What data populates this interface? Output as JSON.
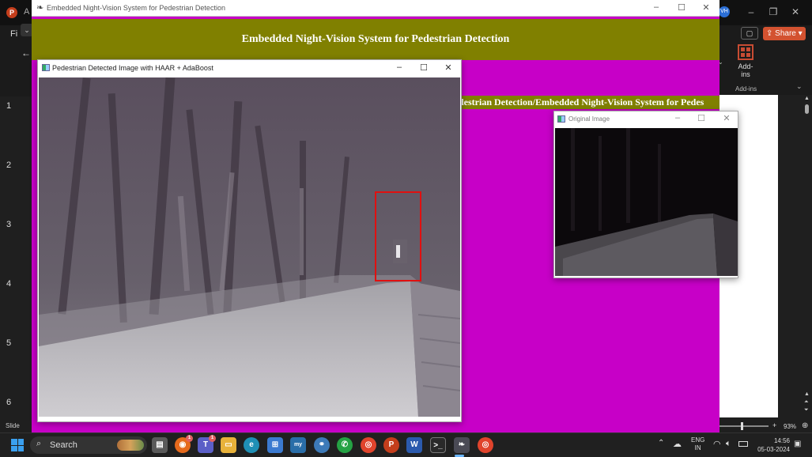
{
  "powerpoint": {
    "title_fragment": "A",
    "file_tab": "Fi",
    "avatar_initials": "VH",
    "share_label": "Share",
    "addins_label": "Add-ins",
    "addins_group_label": "Add-ins",
    "slide_numbers": [
      "1",
      "2",
      "3",
      "4",
      "5",
      "6"
    ],
    "status_text": "Slide",
    "zoom_level": "93%"
  },
  "app": {
    "window_title": "Embedded Night-Vision System for Pedestrian Detection",
    "header_text": "Embedded Night-Vision System for Pedestrian Detection",
    "marquee_text": "destrian Detection/Embedded Night-Vision System for Pedes",
    "colors": {
      "background": "#c700c7",
      "header": "#808000",
      "text": "#ffffff"
    }
  },
  "detected_window": {
    "title": "Pedestrian Detected Image with HAAR + AdaBoost",
    "detection_box_color": "#e01010"
  },
  "original_window": {
    "title": "Original Image"
  },
  "taskbar": {
    "search_label": "Search",
    "apps": [
      "file-icon",
      "firefox-icon",
      "teams-icon",
      "folder-icon",
      "edge-icon",
      "store-icon",
      "mysql-icon",
      "python-icon",
      "whatsapp-icon",
      "chrome-icon",
      "powerpoint-icon",
      "word-icon",
      "terminal-icon",
      "python-idle-icon",
      "chrome-alt-icon"
    ],
    "badges": {
      "firefox": "1",
      "teams": "1"
    },
    "lang_line1": "ENG",
    "lang_line2": "IN",
    "time": "14:56",
    "date": "05-03-2024"
  }
}
